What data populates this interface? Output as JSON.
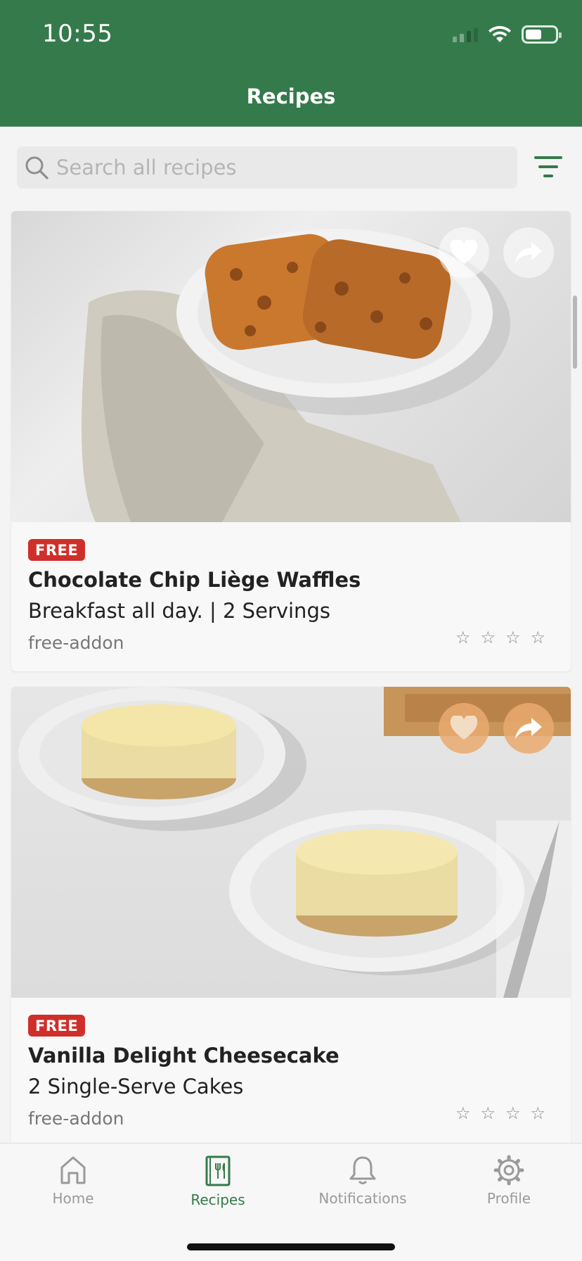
{
  "status_bar": {
    "time": "10:55",
    "battery_level": 0.55
  },
  "header": {
    "title": "Recipes"
  },
  "search": {
    "placeholder": "Search all recipes",
    "value": ""
  },
  "recipes": [
    {
      "badge": "FREE",
      "title": "Chocolate Chip Liège Waffles",
      "subtitle": "Breakfast all day. | 2 Servings",
      "tag": "free-addon",
      "rating": 0,
      "max_rating": 4,
      "image": "waffle-photo",
      "action_style": "light"
    },
    {
      "badge": "FREE",
      "title": "Vanilla Delight Cheesecake",
      "subtitle": "2 Single-Serve Cakes",
      "tag": "free-addon",
      "rating": 0,
      "max_rating": 4,
      "image": "cheesecake-photo",
      "action_style": "orange"
    }
  ],
  "nav": {
    "items": [
      {
        "label": "Home",
        "icon": "home-icon",
        "active": false
      },
      {
        "label": "Recipes",
        "icon": "recipe-book-icon",
        "active": true
      },
      {
        "label": "Notifications",
        "icon": "bell-icon",
        "active": false
      },
      {
        "label": "Profile",
        "icon": "gear-icon",
        "active": false
      }
    ]
  },
  "colors": {
    "brand_green": "#357a4b",
    "badge_red": "#cf2f2a",
    "inactive_gray": "#9a9a9a"
  }
}
